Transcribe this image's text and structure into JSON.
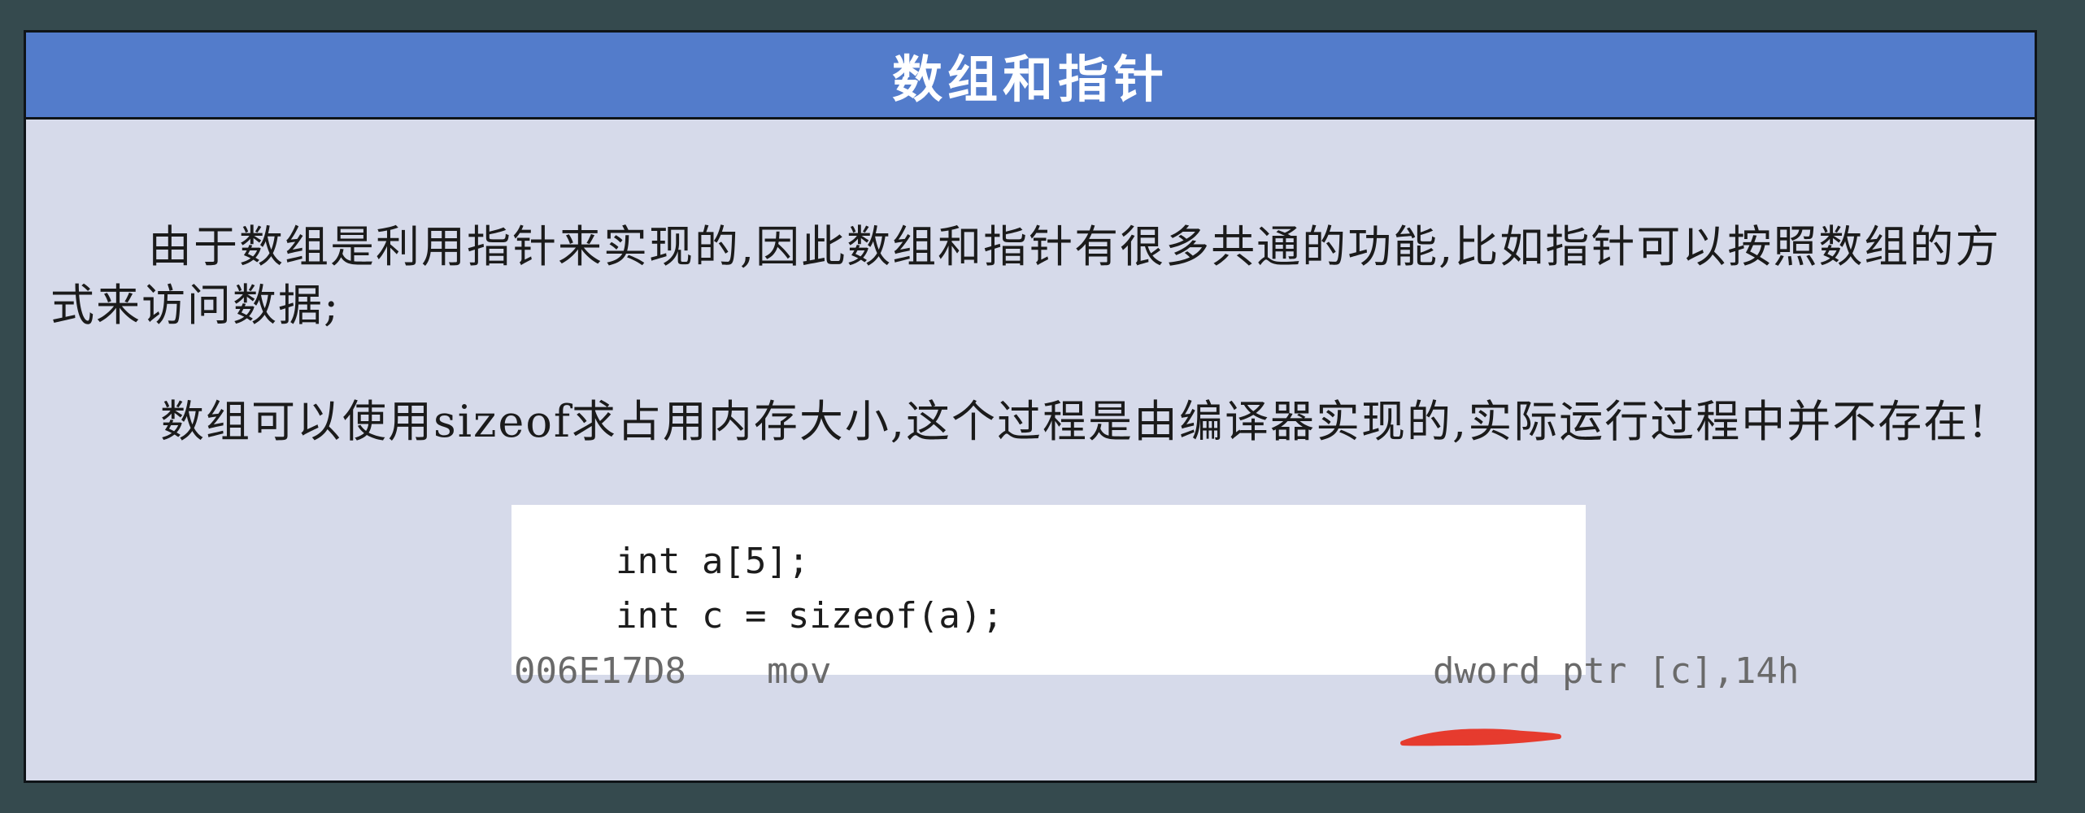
{
  "slide": {
    "title": "数组和指针",
    "paragraph1": "由于数组是利用指针来实现的,因此数组和指针有很多共通的功能,比如指针可以按照数组的方式来访问数据;",
    "paragraph2": "数组可以使用sizeof求占用内存大小,这个过程是由编译器实现的,实际运行过程中并不存在!"
  },
  "code": {
    "line1": "int a[5];",
    "line2": "int c = sizeof(a);",
    "asm_address": "006E17D8",
    "asm_opcode": "mov",
    "asm_operands": "dword ptr [c],14h"
  },
  "colors": {
    "background": "#354a4e",
    "slide_bg": "#d6daea",
    "title_bar": "#537ccb",
    "annotation": "#e63b2e"
  }
}
